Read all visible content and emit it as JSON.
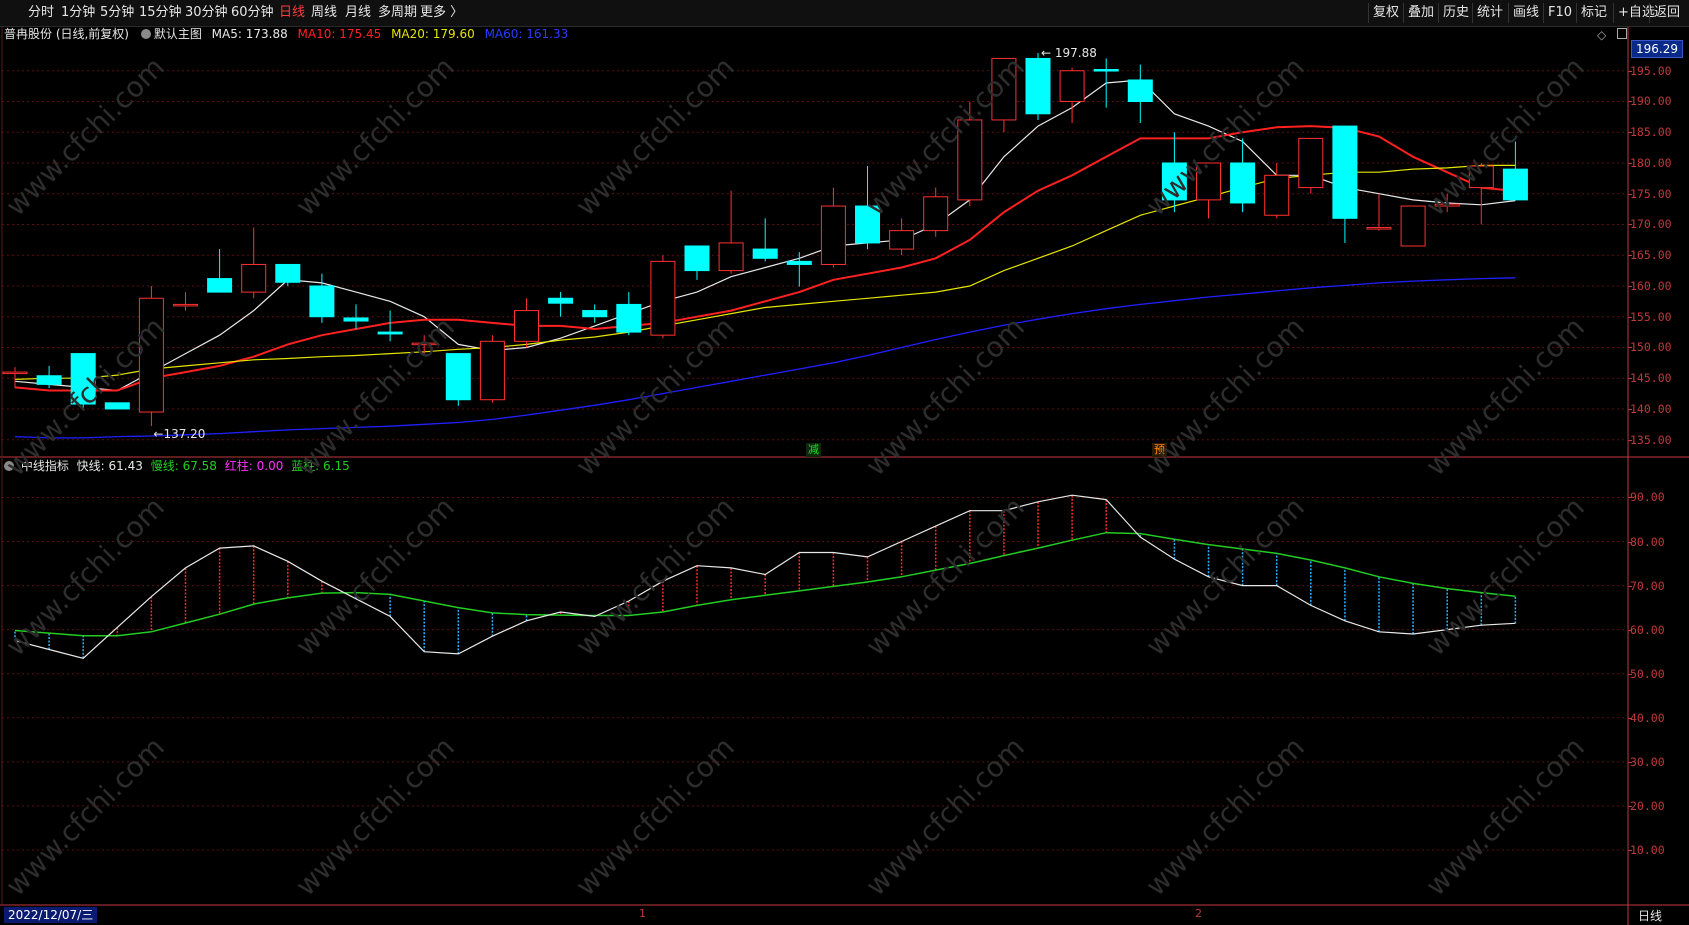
{
  "toolbar": {
    "left": [
      "分时",
      "1分钟",
      "5分钟",
      "15分钟",
      "30分钟",
      "60分钟",
      "日线",
      "周线",
      "月线",
      "多周期",
      "更多 〉"
    ],
    "active": "日线",
    "right": [
      "复权",
      "叠加",
      "历史",
      "统计",
      "画线",
      "F10",
      "标记",
      "+自选",
      "返回"
    ]
  },
  "main": {
    "stock_title": "普冉股份 (日线,前复权)",
    "template": "默认主图",
    "ma5": "MA5: 173.88",
    "ma10": "MA10: 175.45",
    "ma20": "MA20: 179.60",
    "ma60": "MA60: 161.33",
    "price_tag": "196.29",
    "high_label": "197.88",
    "low_label": "137.20",
    "tag_jian": "减",
    "tag_yu": "预"
  },
  "sub": {
    "name": "中线指标",
    "fast": "快线: 61.43",
    "slow": "慢线: 67.58",
    "red": "红柱: 0.00",
    "blue": "蓝柱: 6.15"
  },
  "bottom": {
    "date": "2022/12/07/三",
    "marker1": "1",
    "marker2": "2",
    "period": "日线"
  },
  "watermark": "www.cfchi.com",
  "colors": {
    "up": "#ff3030",
    "down": "#00ffff",
    "ma5": "#e8e8e8",
    "ma10": "#ff2020",
    "ma20": "#e5e500",
    "ma60": "#2020ff",
    "fast": "#e8e8e8",
    "slow": "#22cc22"
  },
  "chart_data": [
    {
      "type": "candlestick",
      "title": "普冉股份 (日线,前复权)",
      "y_ticks": [
        195,
        190,
        185,
        180,
        175,
        170,
        165,
        160,
        155,
        150,
        145,
        140,
        135
      ],
      "ylim": [
        133.0,
        200.0
      ],
      "candles": [
        {
          "o": 146.0,
          "h": 146.8,
          "l": 143.4,
          "c": 146.0
        },
        {
          "o": 145.4,
          "h": 147.0,
          "l": 143.4,
          "c": 144.0
        },
        {
          "o": 149.0,
          "h": 149.0,
          "l": 140.0,
          "c": 140.8
        },
        {
          "o": 141.0,
          "h": 141.0,
          "l": 140.0,
          "c": 140.0
        },
        {
          "o": 139.5,
          "h": 160.0,
          "l": 137.2,
          "c": 158.0
        },
        {
          "o": 156.8,
          "h": 159.0,
          "l": 156.0,
          "c": 157.0
        },
        {
          "o": 161.2,
          "h": 166.0,
          "l": 160.0,
          "c": 159.0
        },
        {
          "o": 159.0,
          "h": 169.5,
          "l": 158.0,
          "c": 163.5
        },
        {
          "o": 163.5,
          "h": 163.5,
          "l": 160.0,
          "c": 160.6
        },
        {
          "o": 160.0,
          "h": 162.0,
          "l": 154.0,
          "c": 155.0
        },
        {
          "o": 154.8,
          "h": 157.0,
          "l": 153.0,
          "c": 154.3
        },
        {
          "o": 152.5,
          "h": 156.0,
          "l": 151.0,
          "c": 152.2
        },
        {
          "o": 150.7,
          "h": 152.0,
          "l": 149.0,
          "c": 150.7
        },
        {
          "o": 149.0,
          "h": 149.0,
          "l": 140.5,
          "c": 141.5
        },
        {
          "o": 141.5,
          "h": 152.0,
          "l": 141.0,
          "c": 151.0
        },
        {
          "o": 151.0,
          "h": 158.0,
          "l": 150.0,
          "c": 156.0
        },
        {
          "o": 158.0,
          "h": 159.0,
          "l": 155.0,
          "c": 157.2
        },
        {
          "o": 156.0,
          "h": 157.0,
          "l": 154.0,
          "c": 155.0
        },
        {
          "o": 157.0,
          "h": 159.0,
          "l": 152.0,
          "c": 152.5
        },
        {
          "o": 152.0,
          "h": 165.0,
          "l": 151.5,
          "c": 164.0
        },
        {
          "o": 166.5,
          "h": 166.5,
          "l": 161.0,
          "c": 162.5
        },
        {
          "o": 162.5,
          "h": 175.5,
          "l": 162.0,
          "c": 167.0
        },
        {
          "o": 166.0,
          "h": 171.0,
          "l": 164.0,
          "c": 164.5
        },
        {
          "o": 164.0,
          "h": 165.5,
          "l": 159.9,
          "c": 163.5
        },
        {
          "o": 163.5,
          "h": 176.0,
          "l": 163.0,
          "c": 173.0
        },
        {
          "o": 173.0,
          "h": 179.5,
          "l": 166.0,
          "c": 167.0
        },
        {
          "o": 166.0,
          "h": 171.0,
          "l": 165.0,
          "c": 169.0
        },
        {
          "o": 169.0,
          "h": 176.0,
          "l": 168.0,
          "c": 174.5
        },
        {
          "o": 174.0,
          "h": 190.0,
          "l": 173.0,
          "c": 187.0
        },
        {
          "o": 187.0,
          "h": 197.0,
          "l": 185.0,
          "c": 197.0
        },
        {
          "o": 197.0,
          "h": 197.88,
          "l": 187.0,
          "c": 188.0
        },
        {
          "o": 190.0,
          "h": 195.5,
          "l": 186.5,
          "c": 195.0
        },
        {
          "o": 195.2,
          "h": 197.0,
          "l": 189.0,
          "c": 195.0
        },
        {
          "o": 193.5,
          "h": 196.0,
          "l": 186.5,
          "c": 190.0
        },
        {
          "o": 180.0,
          "h": 185.0,
          "l": 172.0,
          "c": 174.0
        },
        {
          "o": 174.0,
          "h": 180.0,
          "l": 171.0,
          "c": 180.0
        },
        {
          "o": 180.0,
          "h": 184.0,
          "l": 172.0,
          "c": 173.5
        },
        {
          "o": 171.5,
          "h": 180.0,
          "l": 171.0,
          "c": 178.0
        },
        {
          "o": 176.0,
          "h": 184.0,
          "l": 175.0,
          "c": 184.0
        },
        {
          "o": 186.0,
          "h": 186.0,
          "l": 167.0,
          "c": 171.0
        },
        {
          "o": 169.5,
          "h": 175.0,
          "l": 169.0,
          "c": 169.5
        },
        {
          "o": 166.5,
          "h": 173.0,
          "l": 166.5,
          "c": 173.0
        },
        {
          "o": 173.0,
          "h": 175.0,
          "l": 172.0,
          "c": 173.3
        },
        {
          "o": 176.0,
          "h": 180.0,
          "l": 170.0,
          "c": 179.5
        },
        {
          "o": 179.0,
          "h": 183.5,
          "l": 174.5,
          "c": 174.0
        }
      ],
      "series": [
        {
          "name": "MA5",
          "values": [
            144.5,
            144.0,
            143.5,
            143.0,
            146.0,
            149.0,
            152.0,
            156.0,
            161.0,
            160.5,
            159.0,
            157.5,
            155.0,
            150.5,
            149.5,
            150.0,
            151.5,
            153.5,
            155.5,
            157.5,
            159.0,
            161.5,
            163.0,
            164.5,
            166.5,
            167.0,
            167.5,
            170.0,
            174.0,
            181.0,
            186.0,
            189.0,
            193.0,
            193.5,
            188.0,
            186.0,
            183.5,
            178.0,
            178.0,
            176.0,
            175.0,
            174.0,
            173.5,
            173.2,
            173.88
          ]
        },
        {
          "name": "MA10",
          "values": [
            143.5,
            143.0,
            143.0,
            143.0,
            145.0,
            146.0,
            147.0,
            148.5,
            150.5,
            152.0,
            153.0,
            154.0,
            154.5,
            154.5,
            154.0,
            153.5,
            153.5,
            153.0,
            153.5,
            154.0,
            155.0,
            156.0,
            157.5,
            159.0,
            161.0,
            162.0,
            163.0,
            164.5,
            167.5,
            172.0,
            175.5,
            178.0,
            181.0,
            184.0,
            184.0,
            184.0,
            185.0,
            185.8,
            186.0,
            185.7,
            184.3,
            181.0,
            178.5,
            176.0,
            175.45
          ]
        },
        {
          "name": "MA20",
          "values": [
            144.8,
            145.0,
            145.0,
            145.5,
            146.5,
            147.0,
            147.5,
            148.0,
            148.2,
            148.5,
            148.7,
            149.0,
            149.3,
            149.7,
            150.0,
            150.5,
            151.2,
            151.7,
            152.5,
            153.5,
            154.5,
            155.5,
            156.5,
            157.0,
            157.5,
            158.0,
            158.5,
            159.0,
            160.0,
            162.5,
            164.5,
            166.5,
            169.0,
            171.5,
            173.0,
            174.5,
            176.0,
            177.5,
            178.0,
            178.5,
            178.5,
            179.0,
            179.2,
            179.6,
            179.6
          ]
        },
        {
          "name": "MA60",
          "values": [
            135.5,
            135.3,
            135.3,
            135.5,
            135.6,
            135.8,
            136.0,
            136.3,
            136.6,
            136.8,
            137.0,
            137.2,
            137.5,
            137.8,
            138.3,
            139.0,
            139.8,
            140.6,
            141.5,
            142.5,
            143.5,
            144.5,
            145.5,
            146.5,
            147.5,
            148.7,
            150.0,
            151.3,
            152.5,
            153.6,
            154.6,
            155.5,
            156.3,
            157.0,
            157.6,
            158.2,
            158.7,
            159.2,
            159.7,
            160.1,
            160.5,
            160.8,
            161.0,
            161.2,
            161.33
          ]
        }
      ]
    },
    {
      "type": "line",
      "title": "中线指标",
      "y_ticks": [
        90,
        80,
        70,
        60,
        50,
        40,
        30,
        20,
        10
      ],
      "ylim": [
        0.0,
        96.0
      ],
      "series": [
        {
          "name": "快线",
          "values": [
            57.5,
            55.5,
            53.5,
            60.5,
            67.5,
            74.0,
            78.5,
            79.0,
            75.5,
            71.0,
            67.0,
            63.0,
            55.0,
            54.5,
            58.5,
            62.0,
            64.0,
            63.0,
            66.5,
            71.0,
            74.5,
            74.0,
            72.5,
            77.5,
            77.5,
            76.5,
            80.0,
            83.5,
            87.0,
            87.0,
            89.0,
            90.5,
            89.5,
            81.0,
            76.0,
            72.0,
            70.0,
            70.0,
            65.5,
            62.0,
            59.5,
            59.0,
            60.0,
            61.0,
            61.43
          ]
        },
        {
          "name": "慢线",
          "values": [
            59.8,
            59.2,
            58.6,
            58.6,
            59.5,
            61.5,
            63.5,
            65.8,
            67.2,
            68.3,
            68.4,
            68.0,
            66.5,
            65.0,
            63.8,
            63.4,
            63.3,
            63.2,
            63.2,
            64.0,
            65.5,
            66.8,
            67.8,
            68.8,
            69.8,
            70.8,
            72.0,
            73.5,
            75.0,
            76.8,
            78.5,
            80.3,
            82.0,
            81.8,
            80.5,
            79.3,
            78.3,
            77.3,
            75.8,
            74.0,
            72.0,
            70.5,
            69.3,
            68.4,
            67.58
          ]
        }
      ]
    }
  ]
}
